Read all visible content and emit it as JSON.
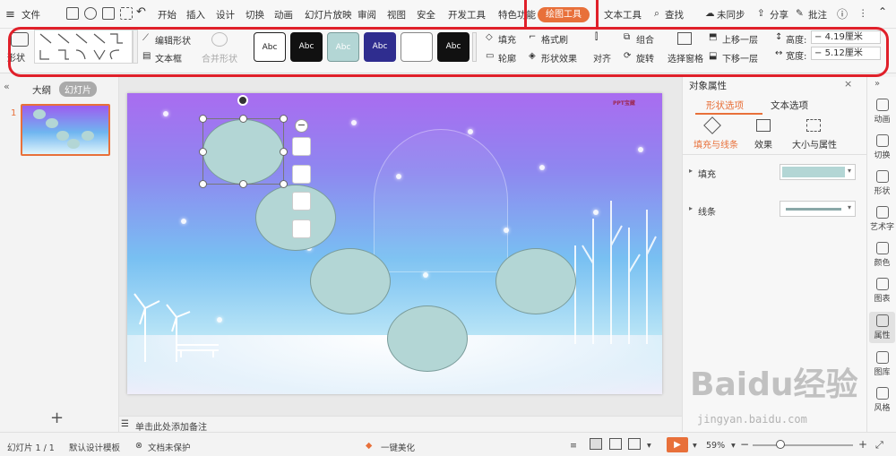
{
  "menubar": {
    "file": "文件",
    "tabs": [
      "开始",
      "插入",
      "设计",
      "切换",
      "动画",
      "幻灯片放映",
      "审阅",
      "视图",
      "安全",
      "开发工具",
      "特色功能"
    ],
    "active_tab": "绘图工具",
    "text_tool": "文本工具",
    "search": "查找",
    "sync": "未同步",
    "share": "分享",
    "annotate": "批注"
  },
  "ribbon": {
    "shape": "形状",
    "edit_shape": "编辑形状",
    "textbox": "文本框",
    "merge_shape": "合并形状",
    "style_abc": "Abc",
    "fill": "填充",
    "format_brush": "格式刷",
    "outline": "轮廓",
    "shape_effect": "形状效果",
    "group": "组合",
    "align": "对齐",
    "rotate": "旋转",
    "select_pane": "选择窗格",
    "bring_forward": "上移一层",
    "send_backward": "下移一层",
    "height_label": "高度:",
    "height_value": "4.19厘米",
    "width_label": "宽度:",
    "width_value": "5.12厘米",
    "minus": "−"
  },
  "leftpanel": {
    "tab_outline": "大纲",
    "tab_slides": "幻灯片",
    "slide_number": "1",
    "add": "+"
  },
  "notes": {
    "placeholder": "单击此处添加备注"
  },
  "rightpanel": {
    "title": "对象属性",
    "tab_shape": "形状选项",
    "tab_text": "文本选项",
    "sub_fill_line": "填充与线条",
    "sub_effect": "效果",
    "sub_size": "大小与属性",
    "fill_label": "填充",
    "line_label": "线条",
    "fill_color": "#b3d6d5",
    "line_color": "#8aa8a8"
  },
  "rightbar": {
    "items": [
      "动画",
      "切换",
      "形状",
      "艺术字",
      "颜色",
      "图表",
      "属性",
      "图库",
      "风格"
    ]
  },
  "statusbar": {
    "slide_info": "幻灯片 1 / 1",
    "template": "默认设计模板",
    "protect": "文档未保护",
    "beautify": "一键美化",
    "zoom": "59%"
  },
  "slide": {
    "logo_text": "PPT宝藏"
  },
  "watermark": {
    "text": "Baidu经验",
    "url": "jingyan.baidu.com"
  },
  "colors": {
    "accent": "#e8703a",
    "highlight": "#e0202a",
    "shape_fill": "#b3d6d5"
  }
}
